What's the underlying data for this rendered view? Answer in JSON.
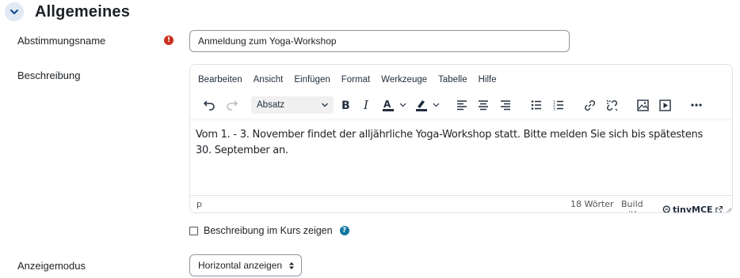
{
  "section": {
    "title": "Allgemeines",
    "expanded": true
  },
  "fields": {
    "name": {
      "label": "Abstimmungsname",
      "value": "Anmeldung zum Yoga-Workshop",
      "required_icon": "!"
    },
    "description": {
      "label": "Beschreibung"
    },
    "display_mode": {
      "label": "Anzeigemodus",
      "value": "Horizontal anzeigen"
    }
  },
  "editor": {
    "menu": [
      "Bearbeiten",
      "Ansicht",
      "Einfügen",
      "Format",
      "Werkzeuge",
      "Tabelle",
      "Hilfe"
    ],
    "block_format": "Absatz",
    "content": "Vom 1. - 3. November findet der alljährliche Yoga-Workshop statt. Bitte melden Sie sich bis spätestens 30. September an.",
    "status_path": "p",
    "word_count": "18 Wörter",
    "build_with": "Build with",
    "brand": "tinyMCE",
    "toolbar_icons": [
      "undo-icon",
      "redo-icon",
      "bold-icon",
      "italic-icon",
      "text-color-icon",
      "highlight-color-icon",
      "align-left-icon",
      "align-center-icon",
      "align-right-icon",
      "bullet-list-icon",
      "numbered-list-icon",
      "link-icon",
      "unlink-icon",
      "image-icon",
      "media-icon",
      "more-icon"
    ]
  },
  "checkbox": {
    "label": "Beschreibung im Kurs zeigen",
    "checked": false,
    "help_icon": "?"
  },
  "colors": {
    "accent": "#0f6cbf",
    "required": "#ca3120",
    "help": "#1177a0"
  }
}
